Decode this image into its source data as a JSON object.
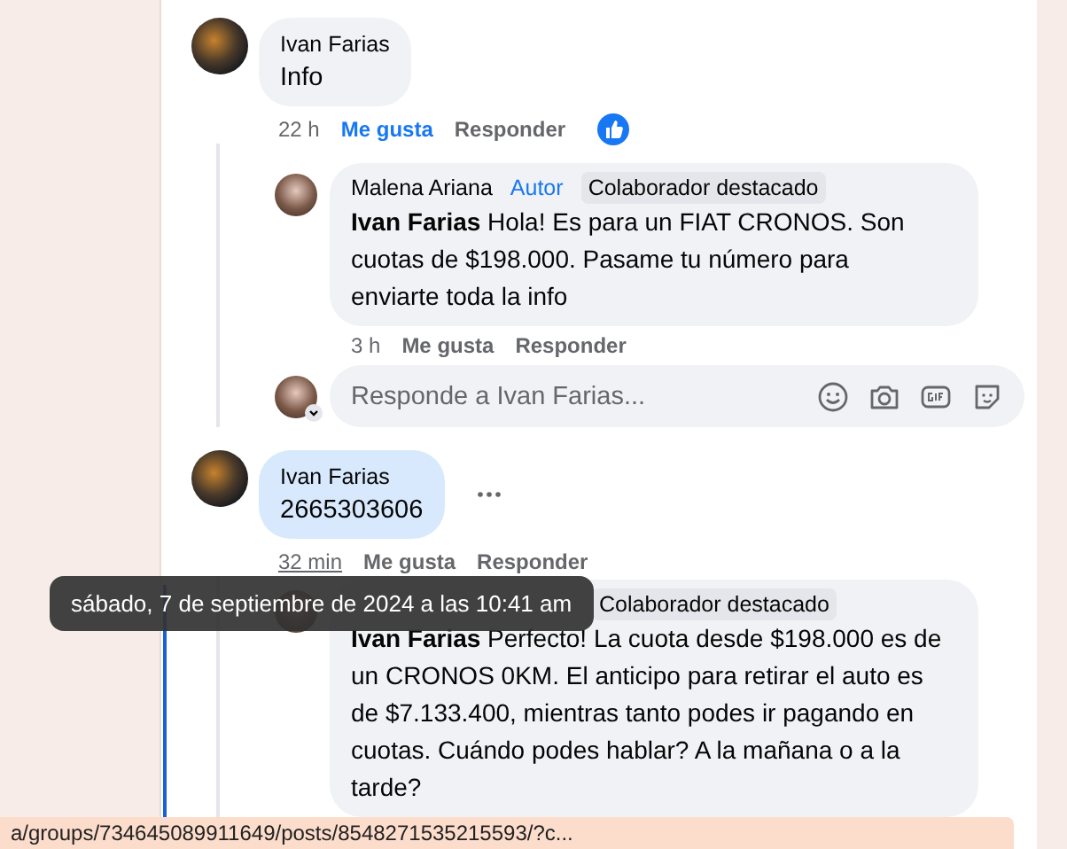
{
  "comments": [
    {
      "author": "Ivan Farias",
      "text": "Info",
      "highlighted": false,
      "time": "22 h",
      "time_hovered": false,
      "like_label": "Me gusta",
      "liked": true,
      "reply_label": "Responder",
      "reaction": true,
      "replies": [
        {
          "author": "Malena Ariana",
          "badges": [
            {
              "label": "Autor",
              "kind": "author"
            },
            {
              "label": "Colaborador destacado",
              "kind": "top_contributor"
            }
          ],
          "mention": "Ivan Farias",
          "text": "Hola! Es para un FIAT CRONOS. Son cuotas de $198.000. Pasame tu número para enviarte toda la info",
          "time": "3 h",
          "like_label": "Me gusta",
          "reply_label": "Responder"
        }
      ],
      "reply_field": {
        "placeholder": "Responde a Ivan Farias..."
      }
    },
    {
      "author": "Ivan Farias",
      "text": "2665303606",
      "highlighted": true,
      "time": "32 min",
      "time_hovered": true,
      "like_label": "Me gusta",
      "liked": false,
      "reply_label": "Responder",
      "more": true,
      "replies": [
        {
          "badges": [
            {
              "label": "Colaborador destacado",
              "kind": "top_contributor"
            }
          ],
          "mention": "Ivan Farias",
          "text": "Perfecto! La cuota desde $198.000 es de un CRONOS 0KM. El anticipo para retirar el auto es de $7.133.400, mientras tanto podes ir pagando en cuotas. Cuándo podes hablar? A la mañana o a la tarde?"
        }
      ]
    }
  ],
  "tooltip": {
    "text": "sábado, 7 de septiembre de 2024 a las 10:41 am"
  },
  "status_bar": {
    "url": "a/groups/734645089911649/posts/8548271535215593/?c..."
  }
}
